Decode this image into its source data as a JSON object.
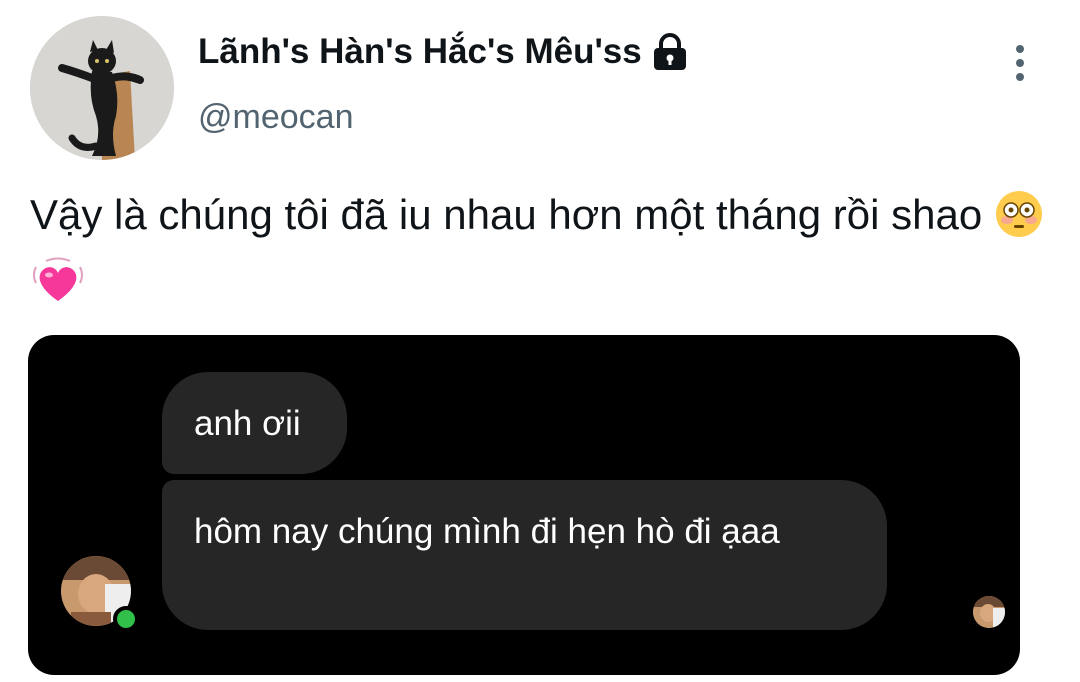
{
  "profile": {
    "display_name": "Lãnh's Hàn's Hắc's Mêu'ss",
    "handle": "@meocan",
    "avatar_icon": "black-cat-avatar-icon",
    "protected_icon": "lock-icon"
  },
  "header": {
    "more_icon": "more-vertical-icon"
  },
  "tweet": {
    "text": "Vậy là chúng tôi đã iu nhau hơn một tháng rồi shao",
    "emojis": [
      "flushed-face-emoji",
      "beating-heart-emoji"
    ]
  },
  "chat_screenshot": {
    "messages": [
      {
        "text": "anh ơii"
      },
      {
        "text": "hôm nay chúng mình đi hẹn hò đi ạaa"
      }
    ],
    "colors": {
      "background": "#000000",
      "bubble": "#262626",
      "online": "#31c04a"
    }
  },
  "colors": {
    "text": "#0f1419",
    "secondary": "#536471",
    "background": "#ffffff"
  }
}
